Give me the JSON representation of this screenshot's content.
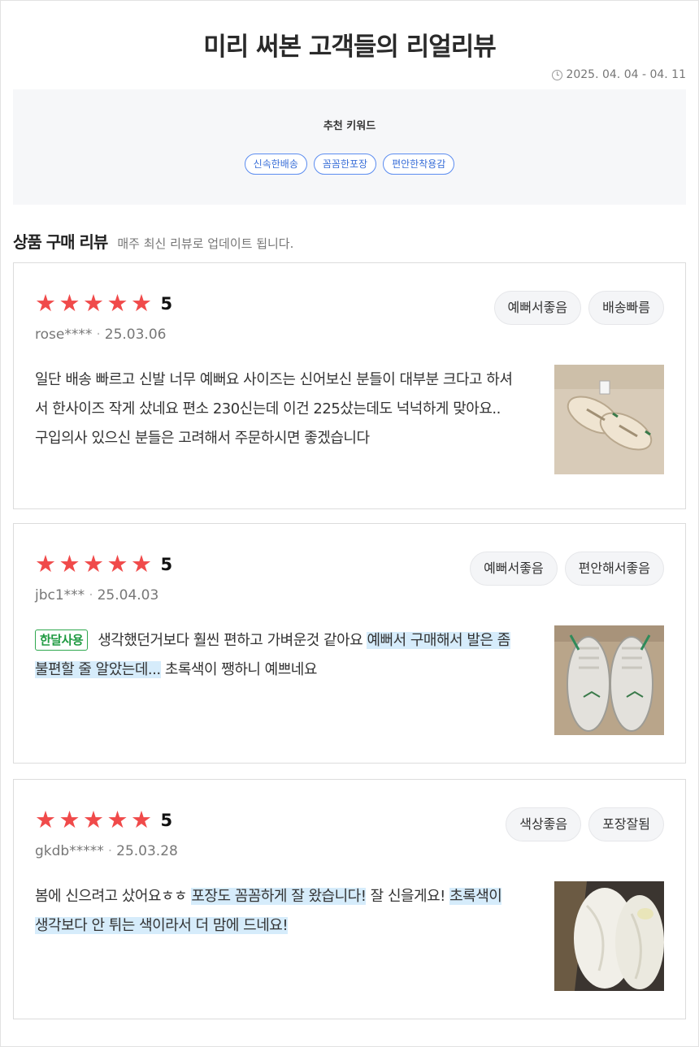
{
  "header": {
    "title": "미리 써본 고객들의 리얼리뷰",
    "date_range": "2025. 04. 04 - 04. 11"
  },
  "keywords": {
    "title": "추천 키워드",
    "tags": [
      "신속한배송",
      "꼼꼼한포장",
      "편안한착용감"
    ]
  },
  "section": {
    "title": "상품 구매 리뷰",
    "subtitle": "매주 최신 리뷰로 업데이트 됩니다."
  },
  "colors": {
    "star": "#f04a4a",
    "highlight": "#d6ecfb",
    "badge": "#1f9a41",
    "keyword_border": "#5b8cf0"
  },
  "reviews": [
    {
      "rating": "5",
      "stars": 5,
      "user": "rose****",
      "date": "25.03.06",
      "chips": [
        "예뻐서좋음",
        "배송빠름"
      ],
      "badge": "",
      "segments": [
        {
          "text": "일단 배송 빠르고 신발 너무 예뻐요 사이즈는 신어보신 분들이 대부분 크다고 하셔서 한사이즈 작게 샀네요 편소 230신는데 이건 225샀는데도 넉넉하게 맞아요.. 구입의사 있으신 분들은 고려해서 주문하시면 좋겠습니다",
          "hl": false
        }
      ],
      "image": "sneakers-beige-pair-photo"
    },
    {
      "rating": "5",
      "stars": 5,
      "user": "jbc1***",
      "date": "25.04.03",
      "chips": [
        "예뻐서좋음",
        "편안해서좋음"
      ],
      "badge": "한달사용",
      "segments": [
        {
          "text": "생각했던거보다 훨씬 편하고 가벼운것 같아요 ",
          "hl": false
        },
        {
          "text": "예뻐서 구매해서 발은 좀 불편할 줄 알았는데...",
          "hl": true
        },
        {
          "text": " 초록색이 쨍하니 예쁘네요",
          "hl": false
        }
      ],
      "image": "sneakers-green-stripe-photo"
    },
    {
      "rating": "5",
      "stars": 5,
      "user": "gkdb*****",
      "date": "25.03.28",
      "chips": [
        "색상좋음",
        "포장잘됨"
      ],
      "badge": "",
      "segments": [
        {
          "text": "봄에 신으려고 샀어요ㅎㅎ ",
          "hl": false
        },
        {
          "text": "포장도 꼼꼼하게 잘 왔습니다!",
          "hl": true
        },
        {
          "text": " 잘 신을게요! ",
          "hl": false
        },
        {
          "text": "초록색이 생각보다 안 튀는 색이라서 더 맘에 드네요!",
          "hl": true
        }
      ],
      "image": "packaged-shoes-photo"
    }
  ]
}
